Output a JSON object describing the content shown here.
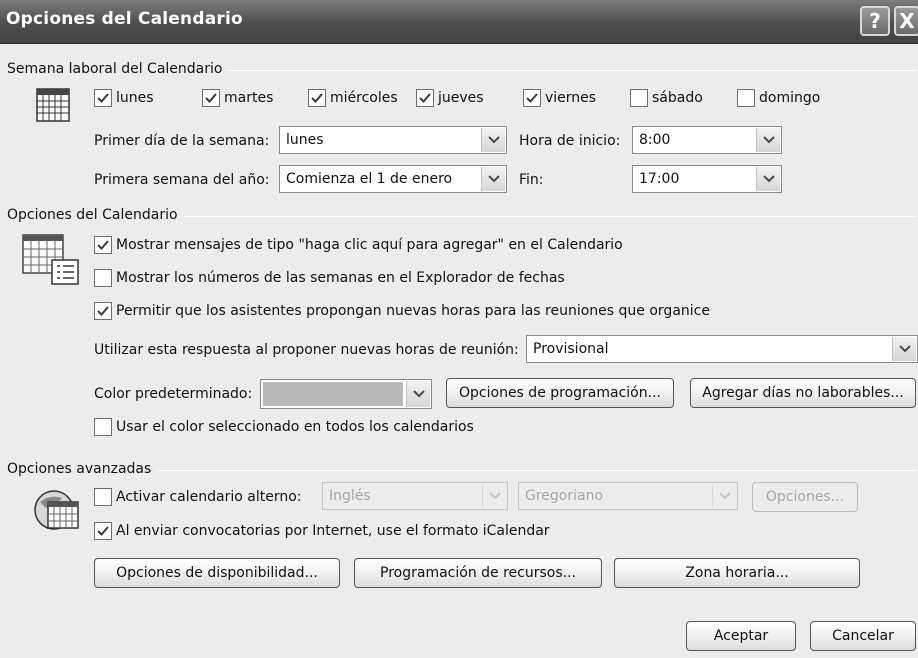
{
  "window": {
    "title": "Opciones del Calendario",
    "help_glyph": "?",
    "close_glyph": "X"
  },
  "work_week": {
    "heading": "Semana laboral del Calendario",
    "days": [
      {
        "label": "lunes",
        "checked": true
      },
      {
        "label": "martes",
        "checked": true
      },
      {
        "label": "miércoles",
        "checked": true
      },
      {
        "label": "jueves",
        "checked": true
      },
      {
        "label": "viernes",
        "checked": true
      },
      {
        "label": "sábado",
        "checked": false
      },
      {
        "label": "domingo",
        "checked": false
      }
    ],
    "first_day_label": "Primer día de la semana:",
    "first_day_value": "lunes",
    "start_time_label": "Hora de inicio:",
    "start_time_value": "8:00",
    "first_week_label": "Primera semana del año:",
    "first_week_value": "Comienza el 1 de enero",
    "end_time_label": "Fin:",
    "end_time_value": "17:00"
  },
  "calendar_options": {
    "heading": "Opciones del Calendario",
    "show_click_to_add": {
      "label": "Mostrar mensajes de tipo \"haga clic aquí para agregar\" en el Calendario",
      "checked": true
    },
    "show_week_numbers": {
      "label": "Mostrar los números de las semanas en el Explorador de fechas",
      "checked": false
    },
    "allow_propose_times": {
      "label": "Permitir que los asistentes propongan nuevas horas para las reuniones que organice",
      "checked": true
    },
    "response_label": "Utilizar esta respuesta al proponer nuevas horas de reunión:",
    "response_value": "Provisional",
    "default_color_label": "Color predeterminado:",
    "default_color": "#b8b8b8",
    "scheduling_button": "Opciones de programación...",
    "add_holidays_button": "Agregar días no laborables...",
    "use_color_all": {
      "label": "Usar el color seleccionado en todos los calendarios",
      "checked": false
    }
  },
  "advanced": {
    "heading": "Opciones avanzadas",
    "alt_calendar": {
      "label": "Activar calendario alterno:",
      "checked": false
    },
    "alt_language_value": "Inglés",
    "alt_type_value": "Gregoriano",
    "alt_options_button": "Opciones...",
    "icalendar": {
      "label": "Al enviar convocatorias por Internet, use el formato iCalendar",
      "checked": true
    },
    "free_busy_button": "Opciones de disponibilidad...",
    "resource_scheduling_button": "Programación de recursos...",
    "time_zone_button": "Zona horaria..."
  },
  "footer": {
    "ok_button": "Aceptar",
    "cancel_button": "Cancelar"
  },
  "colors": {
    "titlebar": "#4e4e4e",
    "dialog_bg": "#ececec"
  }
}
